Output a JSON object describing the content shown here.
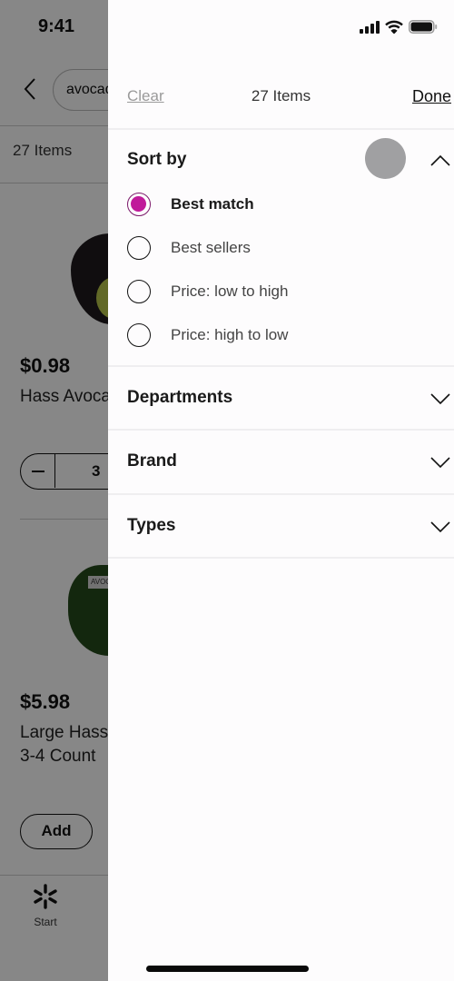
{
  "status_bar": {
    "time": "9:41"
  },
  "background_page": {
    "search_value": "avocados",
    "items_count": "27 Items",
    "products": [
      {
        "price": "$0.98",
        "title": "Hass Avocado",
        "quantity": "3"
      },
      {
        "price": "$5.98",
        "title_line1": "Large Hass Avocados",
        "title_line2": "3-4 Count",
        "add_label": "Add",
        "tag": "AVOCADOS"
      }
    ],
    "tab_bar": {
      "start_label": "Start"
    }
  },
  "filter_panel": {
    "clear_label": "Clear",
    "items_count": "27 Items",
    "done_label": "Done",
    "sort": {
      "title": "Sort by",
      "expanded": true,
      "selected": "Best match",
      "options": [
        {
          "label": "Best match",
          "selected": true
        },
        {
          "label": "Best sellers",
          "selected": false
        },
        {
          "label": "Price: low to high",
          "selected": false
        },
        {
          "label": "Price: high to low",
          "selected": false
        }
      ]
    },
    "sections": [
      {
        "title": "Departments",
        "expanded": false
      },
      {
        "title": "Brand",
        "expanded": false
      },
      {
        "title": "Types",
        "expanded": false
      }
    ]
  },
  "colors": {
    "accent_radio": "#c01a9a",
    "panel_bg": "#fdfcfd",
    "overlay": "#888788"
  }
}
